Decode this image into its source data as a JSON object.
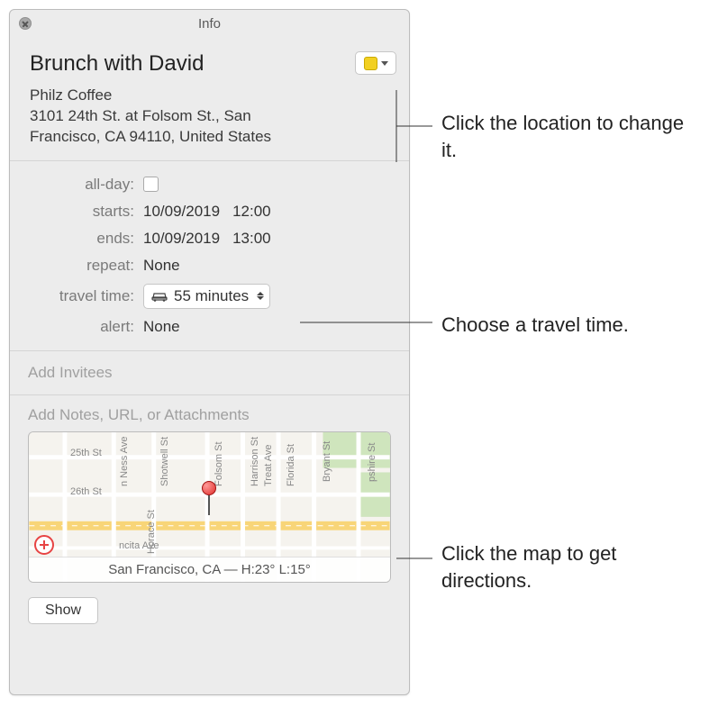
{
  "window": {
    "title": "Info"
  },
  "event": {
    "title": "Brunch with David",
    "location_name": "Philz Coffee",
    "address_line1": "3101 24th St. at Folsom St., San",
    "address_line2": "Francisco, CA 94110, United States"
  },
  "fields": {
    "allday_label": "all-day:",
    "starts_label": "starts:",
    "ends_label": "ends:",
    "repeat_label": "repeat:",
    "travel_label": "travel time:",
    "alert_label": "alert:",
    "start_date": "10/09/2019",
    "start_time": "12:00",
    "end_date": "10/09/2019",
    "end_time": "13:00",
    "repeat_value": "None",
    "travel_value": "55 minutes",
    "alert_value": "None"
  },
  "placeholders": {
    "invitees": "Add Invitees",
    "notes": "Add Notes, URL, or Attachments"
  },
  "map": {
    "weather": "San Francisco, CA — H:23° L:15°",
    "streets_h": [
      "25th St",
      "26th St"
    ],
    "streets_v": [
      "n Ness Ave",
      "Shotwell St",
      "Folsom St",
      "Harrison St",
      "Treat Ave",
      "Florida St",
      "Bryant St",
      "pshire St"
    ],
    "other": [
      "Horace St",
      "ncita Ave"
    ]
  },
  "footer": {
    "show": "Show"
  },
  "callouts": {
    "location": "Click the location to change it.",
    "travel": "Choose a travel time.",
    "map": "Click the map to get directions."
  }
}
